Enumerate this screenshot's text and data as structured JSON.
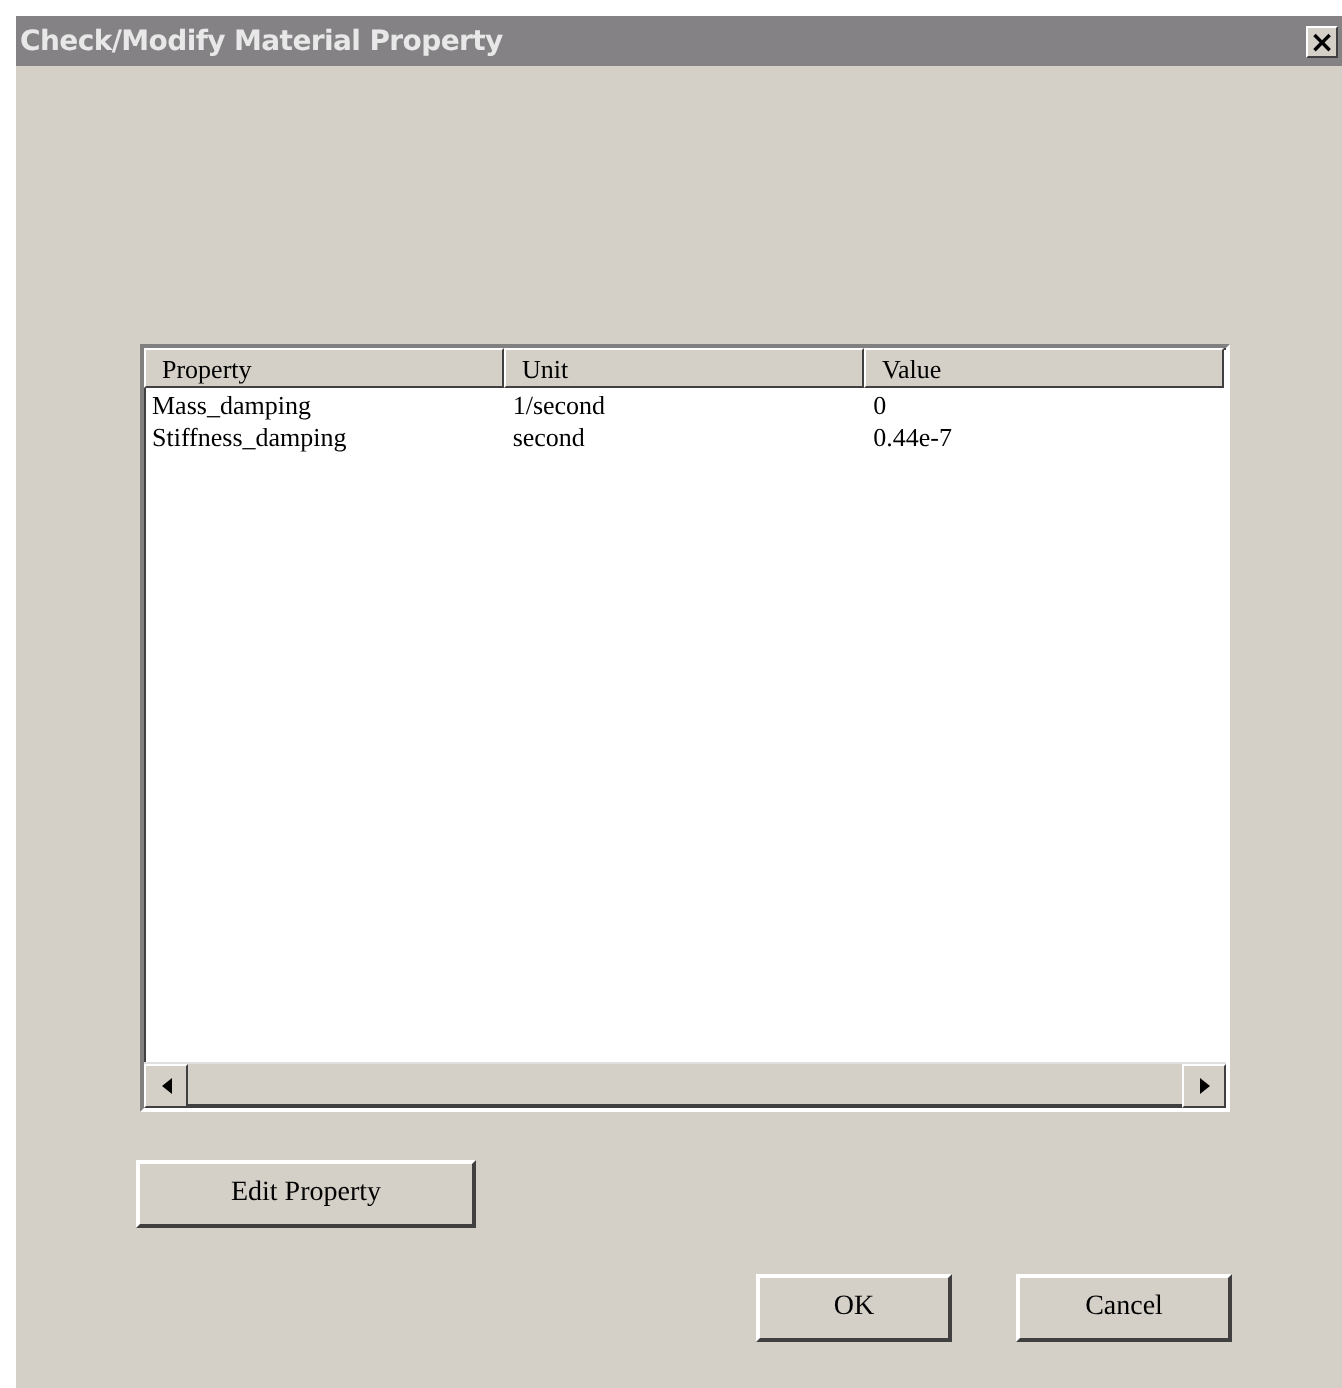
{
  "window": {
    "title": "Check/Modify Material Property",
    "close": "×"
  },
  "table": {
    "columns": [
      "Property",
      "Unit",
      "Value"
    ],
    "rows": [
      {
        "cells": [
          "Mass_damping",
          "1/second",
          "0"
        ]
      },
      {
        "cells": [
          "Stiffness_damping",
          "second",
          "0.44e-7"
        ]
      }
    ]
  },
  "buttons": {
    "edit": "Edit Property",
    "ok": "OK",
    "cancel": "Cancel"
  }
}
